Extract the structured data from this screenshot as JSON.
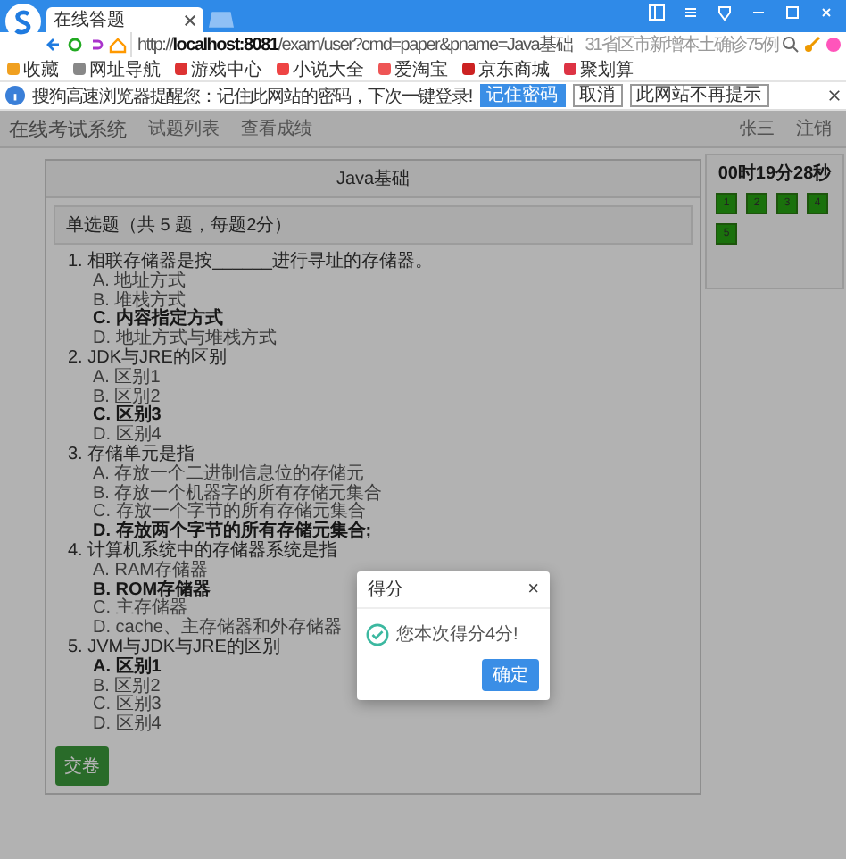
{
  "browser": {
    "tab_title": "在线答题",
    "url": "http://**localhost:8081**/exam/user?cmd=paper&pname=Java基础",
    "search_placeholder": "31省区市新增本土确诊75例",
    "bookmarks": [
      "收藏",
      "网址导航",
      "游戏中心",
      "小说大全",
      "爱淘宝",
      "京东商城",
      "聚划算"
    ],
    "infobar": {
      "message": "搜狗高速浏览器提醒您：记住此网站的密码，下次一键登录!",
      "buttons": [
        {
          "label": "记住密码",
          "kind": "primary"
        },
        {
          "label": "取消",
          "kind": "default"
        },
        {
          "label": "此网站不再提示",
          "kind": "default"
        }
      ]
    }
  },
  "navbar": {
    "brand": "在线考试系统",
    "links": [
      "试题列表",
      "查看成绩"
    ],
    "user": "张三",
    "logout": "注销"
  },
  "paper": {
    "title": "Java基础",
    "section": "单选题（共 5 题，每题2分）",
    "questions": [
      {
        "text": "1. 相联存储器是按______进行寻址的存储器。",
        "options": [
          {
            "label": "A. 地址方式",
            "selected": false
          },
          {
            "label": "B. 堆栈方式",
            "selected": false
          },
          {
            "label": "C. 内容指定方式",
            "selected": true
          },
          {
            "label": "D. 地址方式与堆栈方式",
            "selected": false
          }
        ]
      },
      {
        "text": "2. JDK与JRE的区别",
        "options": [
          {
            "label": "A. 区别1",
            "selected": false
          },
          {
            "label": "B. 区别2",
            "selected": false
          },
          {
            "label": "C. 区别3",
            "selected": true
          },
          {
            "label": "D. 区别4",
            "selected": false
          }
        ]
      },
      {
        "text": "3. 存储单元是指",
        "options": [
          {
            "label": "A. 存放一个二进制信息位的存储元",
            "selected": false
          },
          {
            "label": "B. 存放一个机器字的所有存储元集合",
            "selected": false
          },
          {
            "label": "C. 存放一个字节的所有存储元集合",
            "selected": false
          },
          {
            "label": "D. 存放两个字节的所有存储元集合;",
            "selected": true
          }
        ]
      },
      {
        "text": "4. 计算机系统中的存储器系统是指",
        "options": [
          {
            "label": "A. RAM存储器",
            "selected": false
          },
          {
            "label": "B. ROM存储器",
            "selected": true
          },
          {
            "label": "C. 主存储器",
            "selected": false
          },
          {
            "label": "D. cache、主存储器和外存储器",
            "selected": false
          }
        ]
      },
      {
        "text": "5. JVM与JDK与JRE的区别",
        "options": [
          {
            "label": "A. 区别1",
            "selected": true
          },
          {
            "label": "B. 区别2",
            "selected": false
          },
          {
            "label": "C. 区别3",
            "selected": false
          },
          {
            "label": "D. 区别4",
            "selected": false
          }
        ]
      }
    ],
    "submit": "交卷"
  },
  "timer": {
    "time": "00时19分28秒",
    "questions": [
      {
        "label": "1",
        "answered": true
      },
      {
        "label": "2",
        "answered": true
      },
      {
        "label": "3",
        "answered": true
      },
      {
        "label": "4",
        "answered": true
      },
      {
        "label": "5",
        "answered": true
      }
    ]
  },
  "dialog": {
    "title": "得分",
    "close": "×",
    "message": "您本次得分4分!",
    "ok": "确定"
  }
}
